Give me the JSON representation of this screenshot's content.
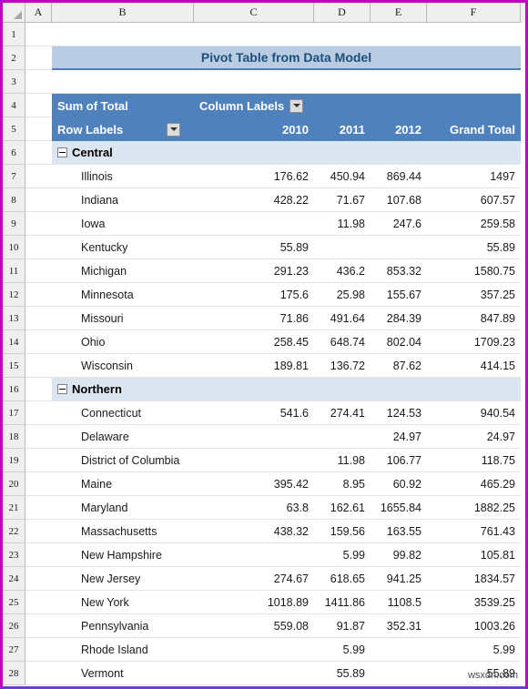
{
  "spreadsheet": {
    "select_all_icon": "select-all-triangle-icon",
    "column_headers": [
      "A",
      "B",
      "C",
      "D",
      "E",
      "F"
    ],
    "row_numbers": [
      "1",
      "2",
      "3",
      "4",
      "5",
      "6",
      "7",
      "8",
      "9",
      "10",
      "11",
      "12",
      "13",
      "14",
      "15",
      "16",
      "17",
      "18",
      "19",
      "20",
      "21",
      "22",
      "23",
      "24",
      "25",
      "26",
      "27",
      "28"
    ]
  },
  "title": {
    "text": "Pivot Table from Data Model"
  },
  "pivot": {
    "value_field_label": "Sum of Total",
    "column_labels": "Column Labels",
    "row_labels": "Row Labels",
    "column_filter_icon": "filter-dropdown-icon",
    "row_filter_icon": "filter-dropdown-icon",
    "collapse_icon": "collapse-minus-icon",
    "columns": [
      "2010",
      "2011",
      "2012",
      "Grand Total"
    ],
    "groups": [
      {
        "name": "Central",
        "rows": [
          {
            "label": "Illinois",
            "v2010": "176.62",
            "v2011": "450.94",
            "v2012": "869.44",
            "total": "1497"
          },
          {
            "label": "Indiana",
            "v2010": "428.22",
            "v2011": "71.67",
            "v2012": "107.68",
            "total": "607.57"
          },
          {
            "label": "Iowa",
            "v2010": "",
            "v2011": "11.98",
            "v2012": "247.6",
            "total": "259.58"
          },
          {
            "label": "Kentucky",
            "v2010": "55.89",
            "v2011": "",
            "v2012": "",
            "total": "55.89"
          },
          {
            "label": "Michigan",
            "v2010": "291.23",
            "v2011": "436.2",
            "v2012": "853.32",
            "total": "1580.75"
          },
          {
            "label": "Minnesota",
            "v2010": "175.6",
            "v2011": "25.98",
            "v2012": "155.67",
            "total": "357.25"
          },
          {
            "label": "Missouri",
            "v2010": "71.86",
            "v2011": "491.64",
            "v2012": "284.39",
            "total": "847.89"
          },
          {
            "label": "Ohio",
            "v2010": "258.45",
            "v2011": "648.74",
            "v2012": "802.04",
            "total": "1709.23"
          },
          {
            "label": "Wisconsin",
            "v2010": "189.81",
            "v2011": "136.72",
            "v2012": "87.62",
            "total": "414.15"
          }
        ]
      },
      {
        "name": "Northern",
        "rows": [
          {
            "label": "Connecticut",
            "v2010": "541.6",
            "v2011": "274.41",
            "v2012": "124.53",
            "total": "940.54"
          },
          {
            "label": "Delaware",
            "v2010": "",
            "v2011": "",
            "v2012": "24.97",
            "total": "24.97"
          },
          {
            "label": "District of Columbia",
            "v2010": "",
            "v2011": "11.98",
            "v2012": "106.77",
            "total": "118.75"
          },
          {
            "label": "Maine",
            "v2010": "395.42",
            "v2011": "8.95",
            "v2012": "60.92",
            "total": "465.29"
          },
          {
            "label": "Maryland",
            "v2010": "63.8",
            "v2011": "162.61",
            "v2012": "1655.84",
            "total": "1882.25"
          },
          {
            "label": "Massachusetts",
            "v2010": "438.32",
            "v2011": "159.56",
            "v2012": "163.55",
            "total": "761.43"
          },
          {
            "label": "New Hampshire",
            "v2010": "",
            "v2011": "5.99",
            "v2012": "99.82",
            "total": "105.81"
          },
          {
            "label": "New Jersey",
            "v2010": "274.67",
            "v2011": "618.65",
            "v2012": "941.25",
            "total": "1834.57"
          },
          {
            "label": "New York",
            "v2010": "1018.89",
            "v2011": "1411.86",
            "v2012": "1108.5",
            "total": "3539.25"
          },
          {
            "label": "Pennsylvania",
            "v2010": "559.08",
            "v2011": "91.87",
            "v2012": "352.31",
            "total": "1003.26"
          },
          {
            "label": "Rhode Island",
            "v2010": "",
            "v2011": "5.99",
            "v2012": "",
            "total": "5.99"
          },
          {
            "label": "Vermont",
            "v2010": "",
            "v2011": "55.89",
            "v2012": "",
            "total": "55.89"
          }
        ]
      }
    ]
  },
  "watermark": {
    "text": "wsxdn.com"
  }
}
